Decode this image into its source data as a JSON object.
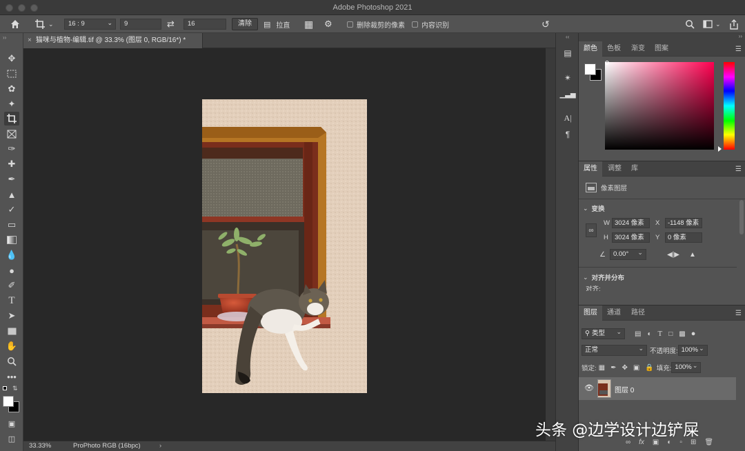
{
  "app": {
    "title": "Adobe Photoshop 2021"
  },
  "options": {
    "ratio": "16 : 9",
    "width": "9",
    "height": "16",
    "clear_label": "清除",
    "straighten_label": "拉直",
    "delete_cropped_label": "删除裁剪的像素",
    "content_aware_label": "内容识别"
  },
  "document": {
    "tab_title": "猫咪与植物-编辑.tif @ 33.3% (图层 0, RGB/16*) *",
    "zoom": "33.33%",
    "profile": "ProPhoto RGB (16bpc)"
  },
  "color_panel": {
    "tabs": [
      "颜色",
      "色板",
      "渐变",
      "图案"
    ],
    "foreground": "#ffffff",
    "background": "#000000",
    "hue_color": "#ff0050"
  },
  "properties_panel": {
    "tabs": [
      "属性",
      "调整",
      "库"
    ],
    "layer_type": "像素图层",
    "transform_label": "变换",
    "w_label": "W",
    "w_value": "3024 像素",
    "h_label": "H",
    "h_value": "3024 像素",
    "x_label": "X",
    "x_value": "-1148 像素",
    "y_label": "Y",
    "y_value": "0 像素",
    "angle_value": "0.00°",
    "align_label": "对齐并分布",
    "align_sub": "对齐:"
  },
  "layers_panel": {
    "tabs": [
      "图层",
      "通道",
      "路径"
    ],
    "filter_type": "类型",
    "blend_mode": "正常",
    "opacity_label": "不透明度:",
    "opacity_value": "100%",
    "lock_label": "锁定:",
    "fill_label": "填充:",
    "fill_value": "100%",
    "layers": [
      {
        "name": "图层 0"
      }
    ],
    "footer_fx": "fx"
  },
  "watermark": "头条 @边学设计边铲屎"
}
